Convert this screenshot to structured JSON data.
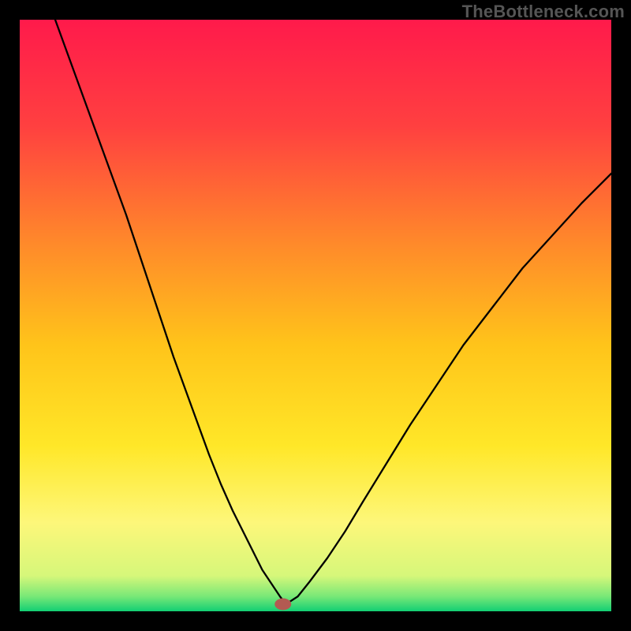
{
  "watermark": "TheBottleneck.com",
  "chart_data": {
    "type": "line",
    "title": "",
    "xlabel": "",
    "ylabel": "",
    "xlim": [
      0,
      100
    ],
    "ylim": [
      0,
      100
    ],
    "grid": false,
    "legend": false,
    "background_gradient_stops": [
      {
        "offset": 0.0,
        "color": "#ff1a4b"
      },
      {
        "offset": 0.18,
        "color": "#ff4040"
      },
      {
        "offset": 0.38,
        "color": "#ff8a2a"
      },
      {
        "offset": 0.55,
        "color": "#ffc41a"
      },
      {
        "offset": 0.72,
        "color": "#ffe728"
      },
      {
        "offset": 0.85,
        "color": "#fdf77a"
      },
      {
        "offset": 0.94,
        "color": "#d6f77a"
      },
      {
        "offset": 0.975,
        "color": "#78e877"
      },
      {
        "offset": 1.0,
        "color": "#12cf74"
      }
    ],
    "series": [
      {
        "name": "bottleneck-curve",
        "stroke": "#000000",
        "stroke_width": 2.3,
        "x": [
          6,
          8,
          10,
          12,
          14,
          16,
          18,
          20,
          22,
          24,
          26,
          28,
          30,
          32,
          34,
          36,
          38,
          40,
          41,
          42,
          43,
          44,
          45,
          47,
          49,
          52,
          55,
          58,
          62,
          66,
          70,
          75,
          80,
          85,
          90,
          95,
          100
        ],
        "y": [
          100,
          94.5,
          89,
          83.5,
          78,
          72.5,
          67,
          61,
          55,
          49,
          43,
          37.5,
          32,
          26.5,
          21.5,
          17,
          13,
          9,
          7,
          5.5,
          4,
          2.5,
          1.2,
          2.5,
          5,
          9,
          13.5,
          18.5,
          25,
          31.5,
          37.5,
          45,
          51.5,
          58,
          63.5,
          69,
          74
        ]
      }
    ],
    "marker": {
      "name": "optimal-point",
      "x": 44.5,
      "y": 1.2,
      "rx": 1.4,
      "ry": 1.0,
      "fill": "#b35a52"
    }
  }
}
